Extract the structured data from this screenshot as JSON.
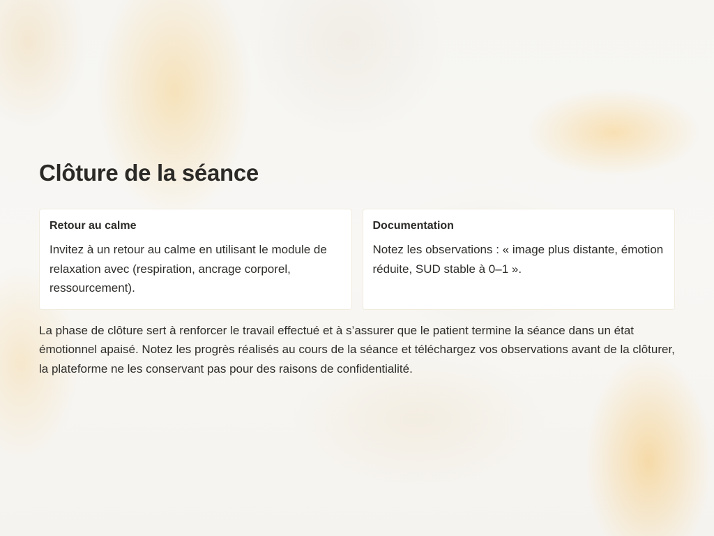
{
  "page": {
    "title": "Clôture de la séance",
    "cards": [
      {
        "title": "Retour au calme",
        "text": "Invitez à un retour au calme en utilisant le module de relaxation avec (respiration, ancrage corporel, ressourcement)."
      },
      {
        "title": "Documentation",
        "text": "Notez les observations : « image plus distante, émotion réduite, SUD stable à 0–1 »."
      }
    ],
    "body": "La phase de clôture sert à renforcer le travail effectué et à s’assurer que le patient termine la séance dans un état émotionnel apaisé. Notez les progrès réalisés au cours de la séance et téléchargez vos observations avant de la clôturer, la plateforme ne les conservant pas pour des raisons de confidentialité."
  }
}
